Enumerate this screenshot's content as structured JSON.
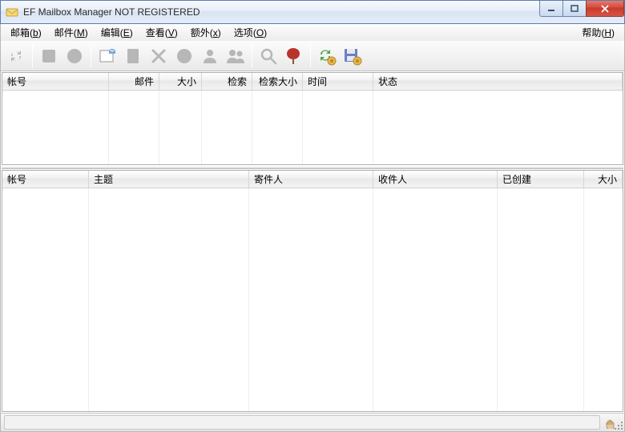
{
  "window": {
    "title": "EF Mailbox Manager NOT REGISTERED"
  },
  "menu": {
    "mailbox": "邮箱",
    "mailbox_u": "b",
    "mail": "邮件",
    "mail_u": "M",
    "edit": "编辑",
    "edit_u": "E",
    "view": "查看",
    "view_u": "V",
    "extra": "额外",
    "extra_u": "x",
    "options": "选项",
    "options_u": "O",
    "help": "帮助",
    "help_u": "H"
  },
  "toolbar_icons": {
    "refresh": "refresh-icon",
    "stop_square": "stop-square-icon",
    "stop_circle": "stop-circle-icon",
    "new_mail": "new-mail-icon",
    "page": "page-icon",
    "delete": "delete-x-icon",
    "mark_read": "mark-read-icon",
    "user": "user-icon",
    "users": "users-icon",
    "search": "search-icon",
    "flag": "flag-icon",
    "sync_settings": "sync-settings-icon",
    "save_settings": "save-settings-icon"
  },
  "top_columns": {
    "c0": "帐号",
    "c1": "邮件",
    "c2": "大小",
    "c3": "检索",
    "c4": "检索大小",
    "c5": "时间",
    "c6": "状态",
    "widths": [
      133,
      63,
      53,
      63,
      63,
      88,
      300
    ]
  },
  "bottom_columns": {
    "c0": "帐号",
    "c1": "主题",
    "c2": "寄件人",
    "c3": "收件人",
    "c4": "已创建",
    "c5": "大小",
    "widths": [
      108,
      200,
      155,
      155,
      108,
      48
    ]
  },
  "status": {
    "text": ""
  }
}
